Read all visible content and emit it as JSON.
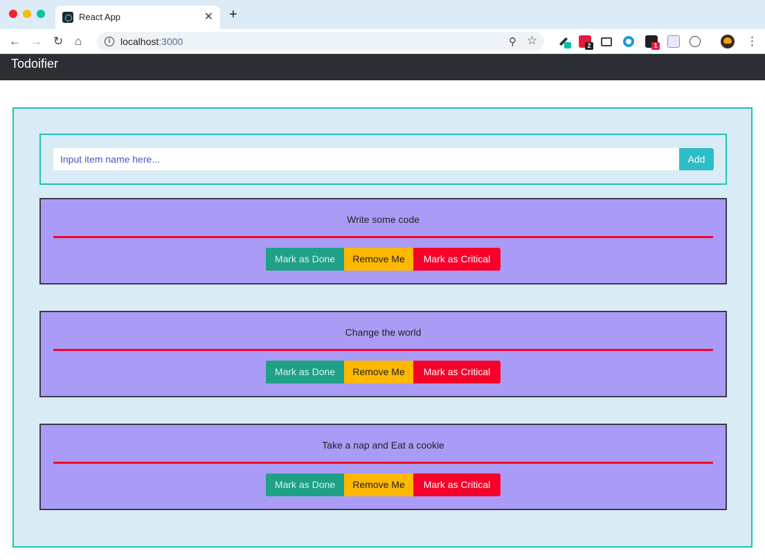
{
  "browser": {
    "tab": {
      "title": "React App",
      "close_glyph": "✕"
    },
    "new_tab_glyph": "+",
    "url": {
      "host": "localhost",
      "port": ":3000"
    },
    "extensions": [
      {
        "icon": "eyedropper-icon"
      },
      {
        "icon": "extension-red-icon",
        "badge": "2"
      },
      {
        "icon": "cast-icon"
      },
      {
        "icon": "zoom-extension-icon"
      },
      {
        "icon": "extension-dark-icon",
        "badge": "1"
      },
      {
        "icon": "extension-purple-icon"
      },
      {
        "icon": "circle-extension-icon"
      },
      {
        "icon": "profile-avatar-icon"
      }
    ]
  },
  "app": {
    "brand": "Todoifier",
    "form": {
      "placeholder": "Input item name here...",
      "add_label": "Add"
    },
    "todos": [
      {
        "title": "Write some code"
      },
      {
        "title": "Change the world"
      },
      {
        "title": "Take a nap and Eat a cookie"
      }
    ],
    "actions": {
      "done_label": "Mark as Done",
      "remove_label": "Remove Me",
      "critical_label": "Mark as Critical"
    },
    "colors": {
      "navbar": "#2b2f34",
      "container_bg": "#d9ebf5",
      "container_border": "#1ec3b0",
      "card_bg": "#aa9cf6",
      "divider": "#f7002a",
      "done": "#1fa186",
      "remove": "#ffb800",
      "critical": "#f7002a",
      "add": "#2cbdc6"
    }
  }
}
